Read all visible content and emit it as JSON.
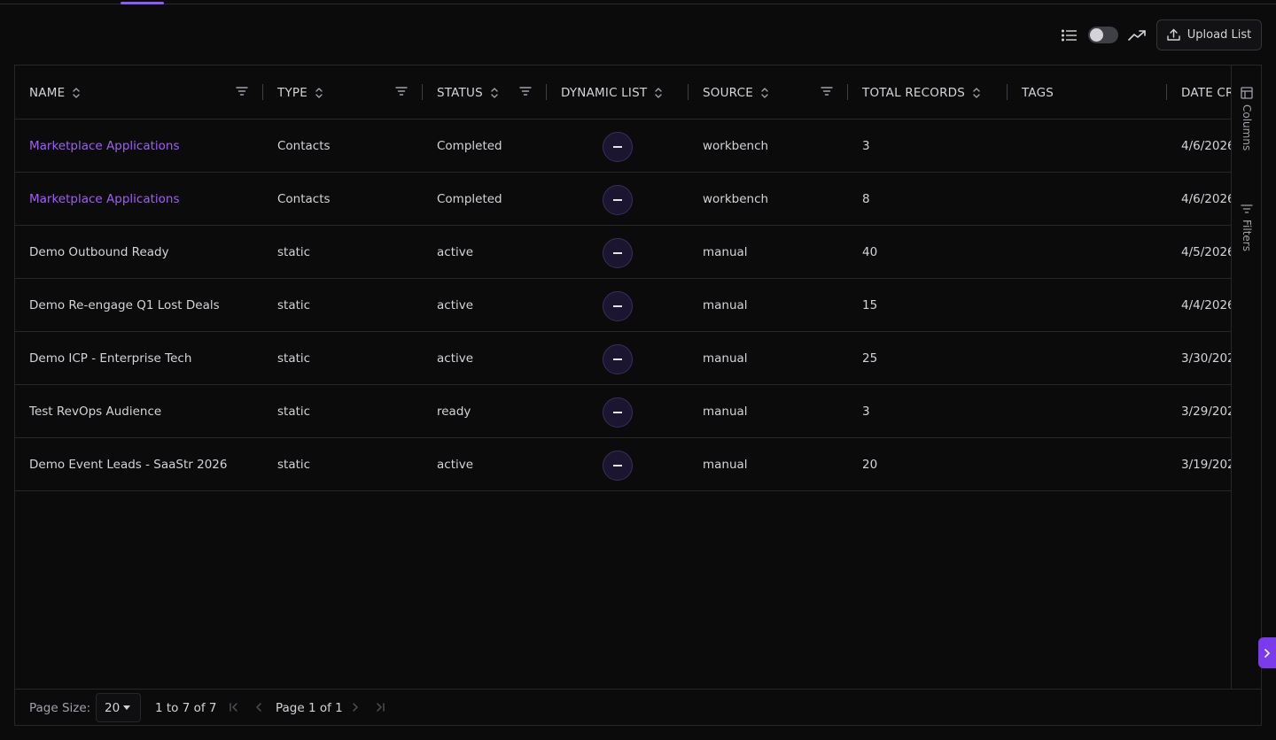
{
  "toolbar": {
    "upload_label": "Upload List",
    "list_view_icon": "list-icon",
    "trend_icon": "trending-up-icon",
    "upload_icon": "upload-icon"
  },
  "grid": {
    "columns": [
      {
        "label": "NAME",
        "sortable": true,
        "filterable": true
      },
      {
        "label": "TYPE",
        "sortable": true,
        "filterable": true
      },
      {
        "label": "STATUS",
        "sortable": true,
        "filterable": true
      },
      {
        "label": "DYNAMIC LIST",
        "sortable": true,
        "filterable": false
      },
      {
        "label": "SOURCE",
        "sortable": true,
        "filterable": true
      },
      {
        "label": "TOTAL RECORDS",
        "sortable": true,
        "filterable": false
      },
      {
        "label": "TAGS",
        "sortable": false,
        "filterable": false
      },
      {
        "label": "DATE CR",
        "sortable": false,
        "filterable": false
      }
    ],
    "rows": [
      {
        "name": "Marketplace Applications",
        "is_link": true,
        "type": "Contacts",
        "status": "Completed",
        "source": "workbench",
        "total": "3",
        "tags": "",
        "date": "4/6/2026"
      },
      {
        "name": "Marketplace Applications",
        "is_link": true,
        "type": "Contacts",
        "status": "Completed",
        "source": "workbench",
        "total": "8",
        "tags": "",
        "date": "4/6/2026"
      },
      {
        "name": "Demo Outbound Ready",
        "is_link": false,
        "type": "static",
        "status": "active",
        "source": "manual",
        "total": "40",
        "tags": "",
        "date": "4/5/2026"
      },
      {
        "name": "Demo Re-engage Q1 Lost Deals",
        "is_link": false,
        "type": "static",
        "status": "active",
        "source": "manual",
        "total": "15",
        "tags": "",
        "date": "4/4/2026"
      },
      {
        "name": "Demo ICP - Enterprise Tech",
        "is_link": false,
        "type": "static",
        "status": "active",
        "source": "manual",
        "total": "25",
        "tags": "",
        "date": "3/30/202"
      },
      {
        "name": "Test RevOps Audience",
        "is_link": false,
        "type": "static",
        "status": "ready",
        "source": "manual",
        "total": "3",
        "tags": "",
        "date": "3/29/202"
      },
      {
        "name": "Demo Event Leads - SaaStr 2026",
        "is_link": false,
        "type": "static",
        "status": "active",
        "source": "manual",
        "total": "20",
        "tags": "",
        "date": "3/19/202"
      }
    ]
  },
  "side_panel": {
    "columns_label": "Columns",
    "filters_label": "Filters"
  },
  "footer": {
    "page_size_label": "Page Size:",
    "page_size_value": "20",
    "range_text": "1 to 7 of 7",
    "page_text": "Page 1 of 1"
  },
  "colors": {
    "accent": "#8b5cf6",
    "link": "#a15cf5",
    "background": "#0b0b0c",
    "border": "#27272a"
  }
}
